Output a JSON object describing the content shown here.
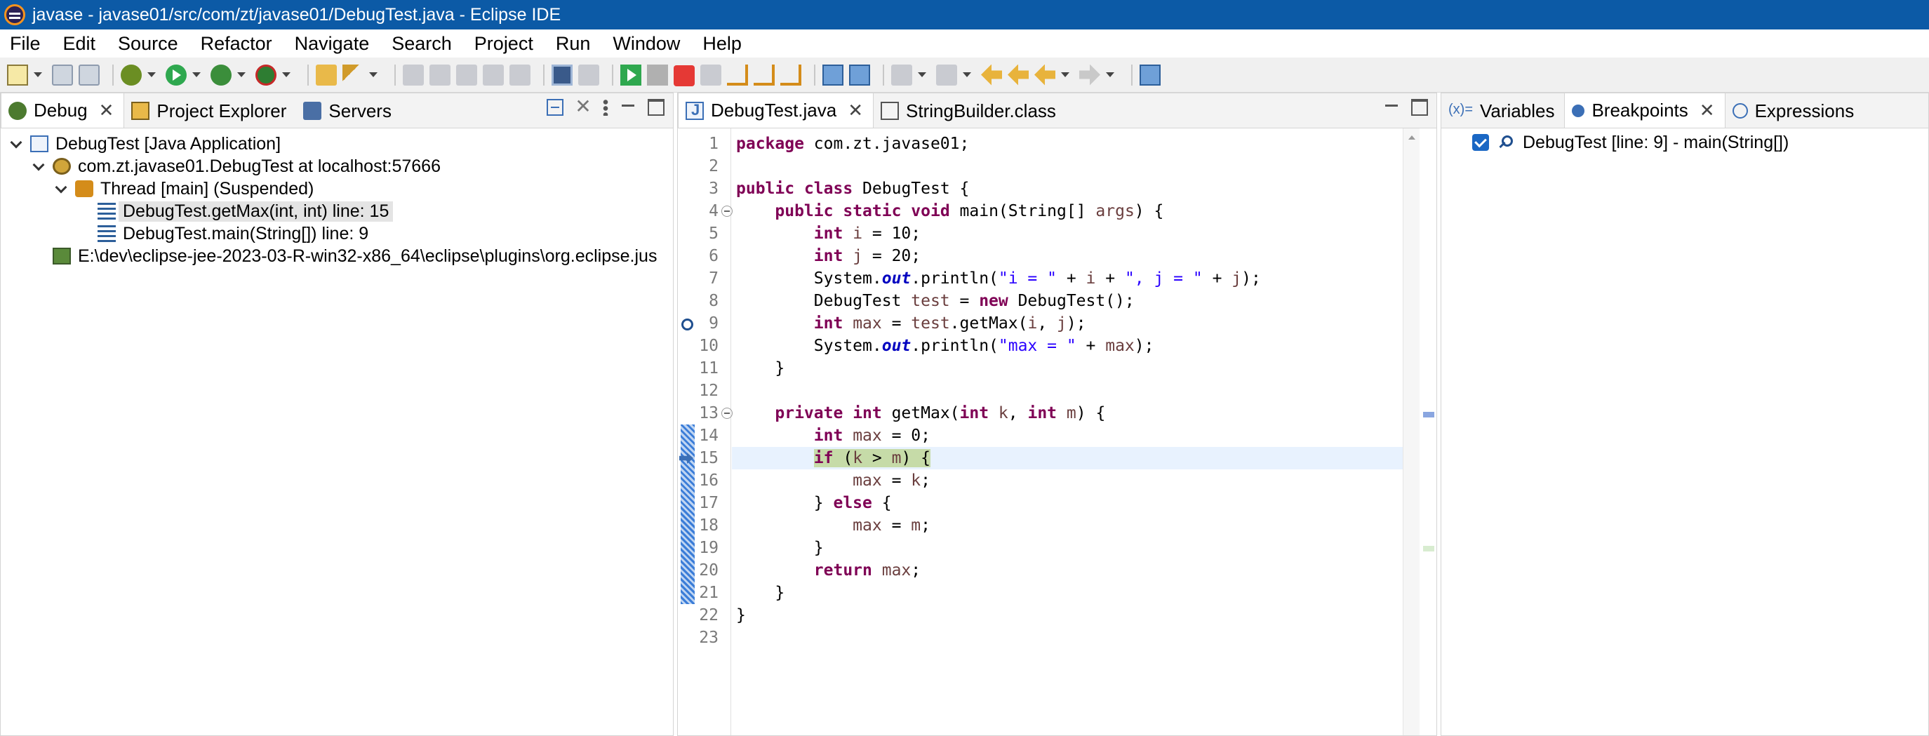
{
  "window": {
    "title": "javase - javase01/src/com/zt/javase01/DebugTest.java - Eclipse IDE"
  },
  "menu": [
    "File",
    "Edit",
    "Source",
    "Refactor",
    "Navigate",
    "Search",
    "Project",
    "Run",
    "Window",
    "Help"
  ],
  "toolbar": {
    "icons": [
      "new-icon",
      "save-icon",
      "save-all-icon",
      "debug-icon",
      "run-icon",
      "coverage-icon",
      "external-tools-icon",
      "open-type-icon",
      "quick-fix-icon",
      "resume-icon",
      "suspend-icon",
      "terminate-icon",
      "step-into-icon",
      "step-over-icon",
      "step-return-icon",
      "back-icon",
      "forward-icon",
      "perspective-icon"
    ]
  },
  "debug_view": {
    "tabs": [
      {
        "label": "Debug",
        "icon": "debug-icon",
        "active": true
      },
      {
        "label": "Project Explorer",
        "icon": "project-explorer-icon"
      },
      {
        "label": "Servers",
        "icon": "servers-icon"
      }
    ],
    "tree": [
      {
        "label": "DebugTest [Java Application]",
        "icon": "java-app-icon",
        "depth": 0,
        "expanded": true
      },
      {
        "label": "com.zt.javase01.DebugTest at localhost:57666",
        "icon": "debug-target-icon",
        "depth": 1,
        "expanded": true
      },
      {
        "label": "Thread [main] (Suspended)",
        "icon": "thread-icon",
        "depth": 2,
        "expanded": true
      },
      {
        "label": "DebugTest.getMax(int, int) line: 15",
        "icon": "stack-frame-icon",
        "depth": 3,
        "selected": true
      },
      {
        "label": "DebugTest.main(String[]) line: 9",
        "icon": "stack-frame-icon",
        "depth": 3
      },
      {
        "label": "E:\\dev\\eclipse-jee-2023-03-R-win32-x86_64\\eclipse\\plugins\\org.eclipse.jus",
        "icon": "process-icon",
        "depth": 1
      }
    ]
  },
  "editor": {
    "tabs": [
      {
        "label": "DebugTest.java",
        "icon": "java-file-icon",
        "active": true
      },
      {
        "label": "StringBuilder.class",
        "icon": "class-file-icon"
      }
    ],
    "current_line": 15,
    "breakpoint_line": 9,
    "fold_lines": [
      4,
      13
    ],
    "highlight_range": [
      14,
      21
    ],
    "lines": [
      [
        {
          "t": "kw",
          "v": "package"
        },
        {
          "t": "plain",
          "v": " com.zt.javase01;"
        }
      ],
      [],
      [
        {
          "t": "kw",
          "v": "public"
        },
        {
          "t": "plain",
          "v": " "
        },
        {
          "t": "kw",
          "v": "class"
        },
        {
          "t": "plain",
          "v": " DebugTest {"
        }
      ],
      [
        {
          "t": "plain",
          "v": "    "
        },
        {
          "t": "kw",
          "v": "public"
        },
        {
          "t": "plain",
          "v": " "
        },
        {
          "t": "kw",
          "v": "static"
        },
        {
          "t": "plain",
          "v": " "
        },
        {
          "t": "kw",
          "v": "void"
        },
        {
          "t": "plain",
          "v": " main(String[] "
        },
        {
          "t": "var",
          "v": "args"
        },
        {
          "t": "plain",
          "v": ") {"
        }
      ],
      [
        {
          "t": "plain",
          "v": "        "
        },
        {
          "t": "kw",
          "v": "int"
        },
        {
          "t": "plain",
          "v": " "
        },
        {
          "t": "var",
          "v": "i"
        },
        {
          "t": "plain",
          "v": " = 10;"
        }
      ],
      [
        {
          "t": "plain",
          "v": "        "
        },
        {
          "t": "kw",
          "v": "int"
        },
        {
          "t": "plain",
          "v": " "
        },
        {
          "t": "var",
          "v": "j"
        },
        {
          "t": "plain",
          "v": " = 20;"
        }
      ],
      [
        {
          "t": "plain",
          "v": "        System."
        },
        {
          "t": "fld",
          "v": "out"
        },
        {
          "t": "plain",
          "v": ".println("
        },
        {
          "t": "str",
          "v": "\"i = \""
        },
        {
          "t": "plain",
          "v": " + "
        },
        {
          "t": "var",
          "v": "i"
        },
        {
          "t": "plain",
          "v": " + "
        },
        {
          "t": "str",
          "v": "\", j = \""
        },
        {
          "t": "plain",
          "v": " + "
        },
        {
          "t": "var",
          "v": "j"
        },
        {
          "t": "plain",
          "v": ");"
        }
      ],
      [
        {
          "t": "plain",
          "v": "        DebugTest "
        },
        {
          "t": "var",
          "v": "test"
        },
        {
          "t": "plain",
          "v": " = "
        },
        {
          "t": "kw",
          "v": "new"
        },
        {
          "t": "plain",
          "v": " DebugTest();"
        }
      ],
      [
        {
          "t": "plain",
          "v": "        "
        },
        {
          "t": "kw",
          "v": "int"
        },
        {
          "t": "plain",
          "v": " "
        },
        {
          "t": "var",
          "v": "max"
        },
        {
          "t": "plain",
          "v": " = "
        },
        {
          "t": "var",
          "v": "test"
        },
        {
          "t": "plain",
          "v": ".getMax("
        },
        {
          "t": "var",
          "v": "i"
        },
        {
          "t": "plain",
          "v": ", "
        },
        {
          "t": "var",
          "v": "j"
        },
        {
          "t": "plain",
          "v": ");"
        }
      ],
      [
        {
          "t": "plain",
          "v": "        System."
        },
        {
          "t": "fld",
          "v": "out"
        },
        {
          "t": "plain",
          "v": ".println("
        },
        {
          "t": "str",
          "v": "\"max = \""
        },
        {
          "t": "plain",
          "v": " + "
        },
        {
          "t": "var",
          "v": "max"
        },
        {
          "t": "plain",
          "v": ");"
        }
      ],
      [
        {
          "t": "plain",
          "v": "    }"
        }
      ],
      [],
      [
        {
          "t": "plain",
          "v": "    "
        },
        {
          "t": "kw",
          "v": "private"
        },
        {
          "t": "plain",
          "v": " "
        },
        {
          "t": "kw",
          "v": "int"
        },
        {
          "t": "plain",
          "v": " getMax("
        },
        {
          "t": "kw",
          "v": "int"
        },
        {
          "t": "plain",
          "v": " "
        },
        {
          "t": "var",
          "v": "k"
        },
        {
          "t": "plain",
          "v": ", "
        },
        {
          "t": "kw",
          "v": "int"
        },
        {
          "t": "plain",
          "v": " "
        },
        {
          "t": "var",
          "v": "m"
        },
        {
          "t": "plain",
          "v": ") {"
        }
      ],
      [
        {
          "t": "plain",
          "v": "        "
        },
        {
          "t": "kw",
          "v": "int"
        },
        {
          "t": "plain",
          "v": " "
        },
        {
          "t": "var",
          "v": "max"
        },
        {
          "t": "plain",
          "v": " = 0;"
        }
      ],
      [
        {
          "t": "plain",
          "v": "        "
        },
        {
          "t": "kw",
          "v": "if",
          "hl": true
        },
        {
          "t": "plain",
          "v": " (",
          "hl": true
        },
        {
          "t": "var",
          "v": "k",
          "hl": true
        },
        {
          "t": "plain",
          "v": " > ",
          "hl": true
        },
        {
          "t": "var",
          "v": "m",
          "hl": true
        },
        {
          "t": "plain",
          "v": ") {",
          "hl": true
        }
      ],
      [
        {
          "t": "plain",
          "v": "            "
        },
        {
          "t": "var",
          "v": "max"
        },
        {
          "t": "plain",
          "v": " = "
        },
        {
          "t": "var",
          "v": "k"
        },
        {
          "t": "plain",
          "v": ";"
        }
      ],
      [
        {
          "t": "plain",
          "v": "        } "
        },
        {
          "t": "kw",
          "v": "else"
        },
        {
          "t": "plain",
          "v": " {"
        }
      ],
      [
        {
          "t": "plain",
          "v": "            "
        },
        {
          "t": "var",
          "v": "max"
        },
        {
          "t": "plain",
          "v": " = "
        },
        {
          "t": "var",
          "v": "m"
        },
        {
          "t": "plain",
          "v": ";"
        }
      ],
      [
        {
          "t": "plain",
          "v": "        }"
        }
      ],
      [
        {
          "t": "plain",
          "v": "        "
        },
        {
          "t": "kw",
          "v": "return"
        },
        {
          "t": "plain",
          "v": " "
        },
        {
          "t": "var",
          "v": "max"
        },
        {
          "t": "plain",
          "v": ";"
        }
      ],
      [
        {
          "t": "plain",
          "v": "    }"
        }
      ],
      [
        {
          "t": "plain",
          "v": "}"
        }
      ],
      []
    ]
  },
  "right_view": {
    "tabs": [
      {
        "label": "Variables",
        "icon": "variables-icon",
        "icon_text": "(x)="
      },
      {
        "label": "Breakpoints",
        "icon": "breakpoints-icon",
        "active": true
      },
      {
        "label": "Expressions",
        "icon": "expressions-icon"
      }
    ],
    "breakpoints": [
      {
        "label": "DebugTest [line: 9] - main(String[])",
        "enabled": true
      }
    ]
  },
  "colors": {
    "titlebar": "#0c5aa6",
    "current_line": "#e8f2fe",
    "current_instruction": "#c6dba8",
    "keyword": "#7f0055",
    "string": "#2a00ff",
    "local_variable": "#6a3e3e",
    "static_field": "#0000c0"
  }
}
